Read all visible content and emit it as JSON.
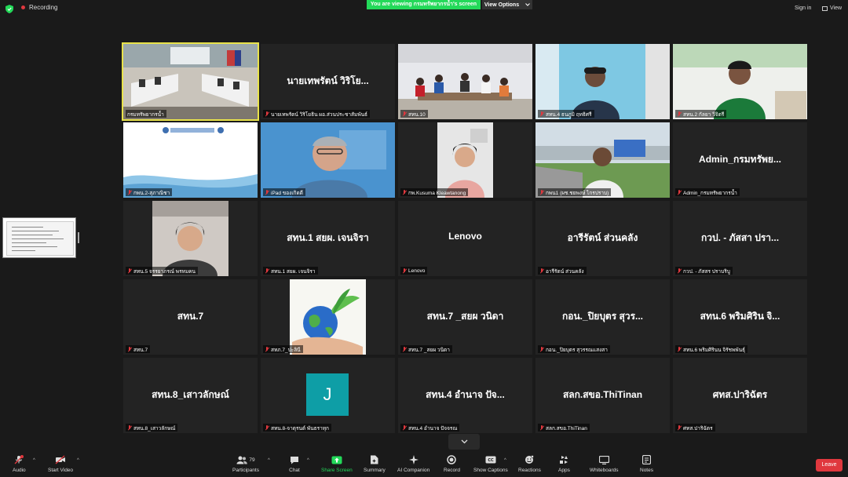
{
  "topbar": {
    "recording": "Recording",
    "viewing_banner": "You are viewing กรมทรัพยากรน้ำ's screen",
    "view_options": "View Options",
    "sign_in": "Sign in",
    "view": "View"
  },
  "tiles": [
    {
      "kind": "video",
      "label": "กรมทรัพยากรน้ำ",
      "scene": "meeting-room",
      "active": true,
      "muted": false
    },
    {
      "kind": "name",
      "bigname": "นายเทพรัตน์ วิริโย...",
      "label": "นายเทพรัตน์ วิริโยธิน ผอ.ส่วนประชาสัมพันธ์",
      "muted": true
    },
    {
      "kind": "video",
      "label": "สทน.10",
      "scene": "office-table",
      "muted": true
    },
    {
      "kind": "video",
      "label": "สทน.4 ธนภูมิ ฤทธิศรี",
      "scene": "person-window",
      "muted": true
    },
    {
      "kind": "video",
      "label": "สทน.2 กัลยา วิจิตรี",
      "scene": "person-green",
      "muted": true
    },
    {
      "kind": "video",
      "label": "กพน.2-สุภาณิชา",
      "scene": "slide",
      "muted": true
    },
    {
      "kind": "video",
      "label": "iPad ของเกิดดี",
      "scene": "person-blue",
      "muted": true
    },
    {
      "kind": "video",
      "label": "กพ.Kusuma Kleawtanong",
      "scene": "person-woman",
      "muted": true
    },
    {
      "kind": "video",
      "label": "กพน1 (ผช.ชยพงษ์ ไกรปราบ)",
      "scene": "person-outdoor",
      "muted": true
    },
    {
      "kind": "name",
      "bigname": "Admin_กรมทรัพย...",
      "label": "Admin_กรมทรัพยากรน้ำ",
      "muted": true
    },
    {
      "kind": "video",
      "label": "สทน.5 จรรยาภรณ์ พรหมคน",
      "scene": "person-car",
      "muted": true
    },
    {
      "kind": "name",
      "bigname": "สทน.1 สยผ. เจนจิรา",
      "label": "สทน.1 สยผ. เจนจิรา",
      "muted": true
    },
    {
      "kind": "name",
      "bigname": "Lenovo",
      "label": "Lenovo",
      "muted": true
    },
    {
      "kind": "name",
      "bigname": "อารีรัตน์ ส่วนคลัง",
      "label": "อารีรัตน์ ส่วนคลัง",
      "muted": true
    },
    {
      "kind": "name",
      "bigname": "กวป. - ภัสสา ปรา...",
      "label": "กวป. - ภัสสร ปราบริบู",
      "muted": true
    },
    {
      "kind": "name",
      "bigname": "สทน.7",
      "label": "สทน.7",
      "muted": true
    },
    {
      "kind": "video",
      "label": "สทภ.7_ปะลินี",
      "scene": "earth-hands",
      "muted": true
    },
    {
      "kind": "name",
      "bigname": "สทน.7 _สยผ วนิดา",
      "label": "สทน.7 _สยผ วนิดา",
      "muted": true
    },
    {
      "kind": "name",
      "bigname": "กอน._ปิยบุตร สุวร...",
      "label": "กอน._ปิยบุตร สุวรรณแสงสา",
      "muted": true
    },
    {
      "kind": "name",
      "bigname": "สทน.6 พริมศิริน จิ...",
      "label": "สทน.6 พริมศิรินน จิรัชพพันธุ์",
      "muted": true
    },
    {
      "kind": "name",
      "bigname": "สทน.8_เสาวลักษณ์",
      "label": "สทน.8_เสาวลักษณ์",
      "muted": true
    },
    {
      "kind": "avatar",
      "initial": "J",
      "label": "สทน.8-จาตุรนต์ พันธราทุก",
      "muted": true
    },
    {
      "kind": "name",
      "bigname": "สทน.4 อำนาจ ปัจ...",
      "label": "สทน.4 อำนาจ ปัจจรณ",
      "muted": true
    },
    {
      "kind": "name",
      "bigname": "สลก.สขอ.ThiTinan",
      "label": "สลก.สขอ.ThiTinan",
      "muted": true
    },
    {
      "kind": "name",
      "bigname": "ศทส.ปาริฉัตร",
      "label": "ศทส.ปาริฉัตร",
      "muted": true
    }
  ],
  "toolbar": {
    "audio": "Audio",
    "start_video": "Start Video",
    "participants": "Participants",
    "participants_count": "79",
    "chat": "Chat",
    "share_screen": "Share Screen",
    "summary": "Summary",
    "ai_companion": "AI Companion",
    "record": "Record",
    "show_captions": "Show Captions",
    "reactions": "Reactions",
    "apps": "Apps",
    "whiteboards": "Whiteboards",
    "notes": "Notes",
    "leave": "Leave"
  },
  "colors": {
    "background": "#1a1a1a",
    "tile": "#232323",
    "viewing_banner": "#23d959",
    "leave": "#e0383e",
    "active_outline": "#e8e24a",
    "avatar": "#0e9ea6"
  }
}
